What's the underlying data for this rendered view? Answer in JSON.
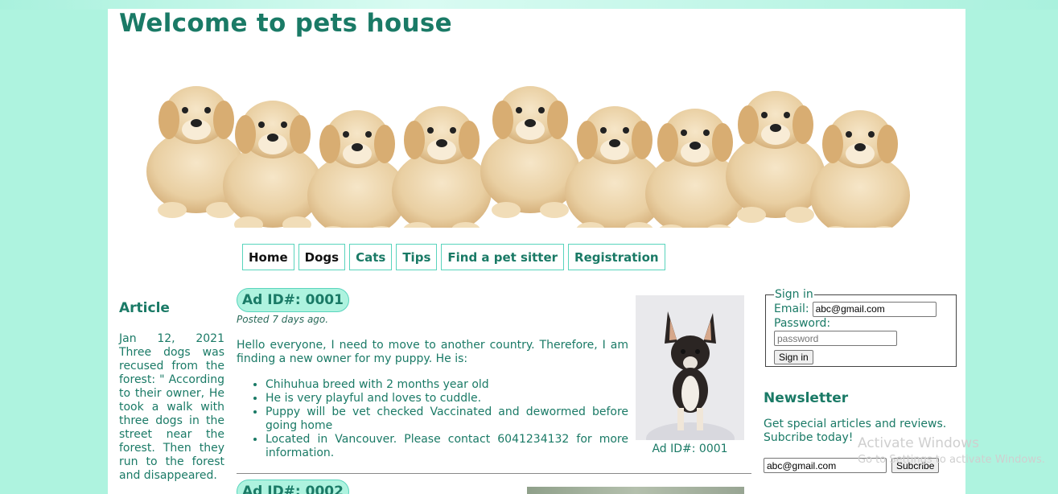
{
  "site": {
    "title": "Welcome to pets house"
  },
  "nav": [
    {
      "label": "Home",
      "dark": true
    },
    {
      "label": "Dogs",
      "dark": true
    },
    {
      "label": "Cats",
      "dark": false
    },
    {
      "label": "Tips",
      "dark": false
    },
    {
      "label": "Find a pet sitter",
      "dark": false
    },
    {
      "label": "Registration",
      "dark": false
    }
  ],
  "article": {
    "heading": "Article",
    "text": "Jan 12, 2021 Three dogs was recused from the forest: \" According to their owner, He took a walk with three dogs in the street near the forest. Then they run to the forest and disappeared."
  },
  "ad1": {
    "id_label": "Ad ID#: 0001",
    "posted": "Posted 7 days ago.",
    "intro": "Hello everyone, I need to move to another country. Therefore, I am finding a new owner for my puppy. He is:",
    "bullets": [
      "Chihuhua breed with 2 months year old",
      "He is very playful and loves to cuddle.",
      "Puppy will be vet checked Vaccinated and dewormed before going home",
      "Located in Vancouver. Please contact 6041234132 for more information."
    ],
    "photo_caption": "Ad ID#: 0001"
  },
  "ad2": {
    "id_label": "Ad ID#: 0002"
  },
  "signin": {
    "legend": "Sign in",
    "email_label": "Email:",
    "email_value": "abc@gmail.com",
    "password_label": "Password:",
    "password_placeholder": "password",
    "button": "Sign in"
  },
  "newsletter": {
    "heading": "Newsletter",
    "text": "Get special articles and reviews. Subcribe today!",
    "email_value": "abc@gmail.com",
    "button": "Subcribe"
  },
  "watermark": {
    "line1": "Activate Windows",
    "line2": "Go to Settings to activate Windows."
  },
  "colors": {
    "accent": "#1a7a66",
    "background": "#aef3df",
    "border": "#59d4bd"
  }
}
